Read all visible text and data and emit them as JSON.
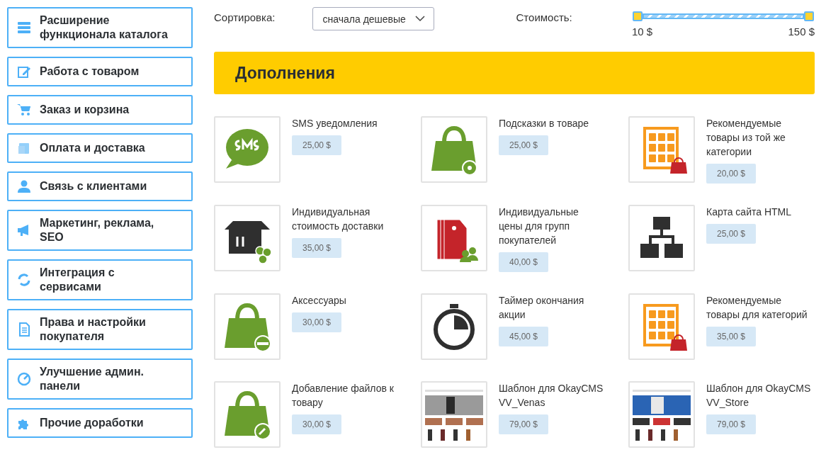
{
  "sidebar": {
    "items": [
      {
        "label": "Расширение функционала каталога",
        "selected": false
      },
      {
        "label": "Работа с товаром",
        "selected": false
      },
      {
        "label": "Заказ и корзина",
        "selected": false
      },
      {
        "label": "Оплата и доставка",
        "selected": false
      },
      {
        "label": "Связь с клиентами",
        "selected": false
      },
      {
        "label": "Маркетинг, реклама, SEO",
        "selected": false
      },
      {
        "label": "Интеграция с сервисами",
        "selected": false
      },
      {
        "label": "Права и настройки покупателя",
        "selected": false
      },
      {
        "label": "Улучшение админ. панели",
        "selected": false
      },
      {
        "label": "Прочие доработки",
        "selected": false
      }
    ]
  },
  "sort": {
    "label": "Сортировка:",
    "value": "сначала дешевые"
  },
  "price_filter": {
    "label": "Стоимость:",
    "level": 1,
    "min": "10 $",
    "max": "150 $"
  },
  "section": {
    "title": "Дополнения"
  },
  "products": [
    {
      "kind": "icon",
      "name": "SMS уведомления",
      "price": "25,00 $"
    },
    {
      "kind": "icon",
      "name": "Подсказки в товаре",
      "price": "25,00 $"
    },
    {
      "kind": "icon",
      "name": "Рекомендуемые товары из той же категории",
      "price": "20,00 $"
    },
    {
      "kind": "icon",
      "name": "Индивидуальная стоимость доставки",
      "price": "35,00 $"
    },
    {
      "kind": "icon",
      "name": "Индивидуальные цены для групп покупателей",
      "price": "40,00 $"
    },
    {
      "kind": "icon",
      "name": "Карта сайта HTML",
      "price": "25,00 $"
    },
    {
      "kind": "icon",
      "name": "Аксессуары",
      "price": "30,00 $"
    },
    {
      "kind": "icon",
      "name": "Таймер окончания акции",
      "price": "45,00 $"
    },
    {
      "kind": "icon",
      "name": "Рекомендуемые товары для категорий",
      "price": "35,00 $"
    },
    {
      "kind": "icon",
      "name": "Добавление файлов к товару",
      "price": "30,00 $"
    },
    {
      "kind": "picture",
      "name": "Шаблон для OkayCMS VV_Venas",
      "price": "79,00 $"
    },
    {
      "kind": "picture",
      "name": "Шаблон для OkayCMS VV_Store",
      "price": "79,00 $"
    }
  ]
}
